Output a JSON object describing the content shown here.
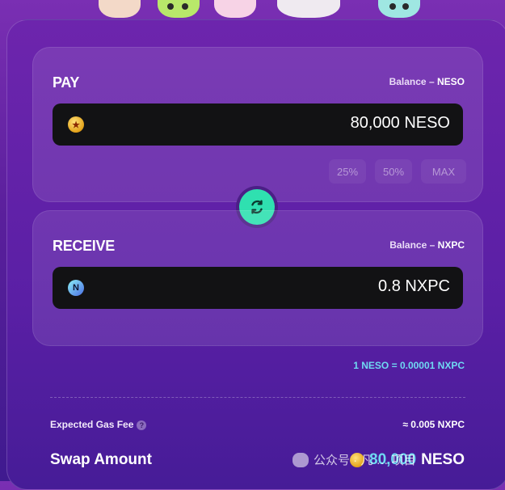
{
  "pay": {
    "title": "PAY",
    "balance_label": "Balance",
    "balance_sep": "–",
    "balance_token": "NESO",
    "amount": "80,000",
    "token": "NESO",
    "percentages": [
      "25%",
      "50%",
      "MAX"
    ]
  },
  "receive": {
    "title": "RECEIVE",
    "balance_label": "Balance",
    "balance_sep": "–",
    "balance_token": "NXPC",
    "amount": "0.8",
    "token": "NXPC"
  },
  "rate": "1 NESO = 0.00001 NXPC",
  "gas": {
    "label": "Expected Gas Fee",
    "help": "?",
    "value": "≈ 0.005 NXPC"
  },
  "swap": {
    "label": "Swap Amount",
    "amount": "80,000",
    "token": "NESO"
  },
  "watermark": "公众号 · 凡 … 项目",
  "icons": {
    "pay_token": "neso-coin-icon",
    "receive_token": "nxpc-coin-icon",
    "swap": "swap-arrows-icon",
    "help": "help-icon"
  },
  "colors": {
    "accent": "#2fe0b0",
    "rate": "#6fd9f2",
    "background": "#5a1fa5"
  }
}
